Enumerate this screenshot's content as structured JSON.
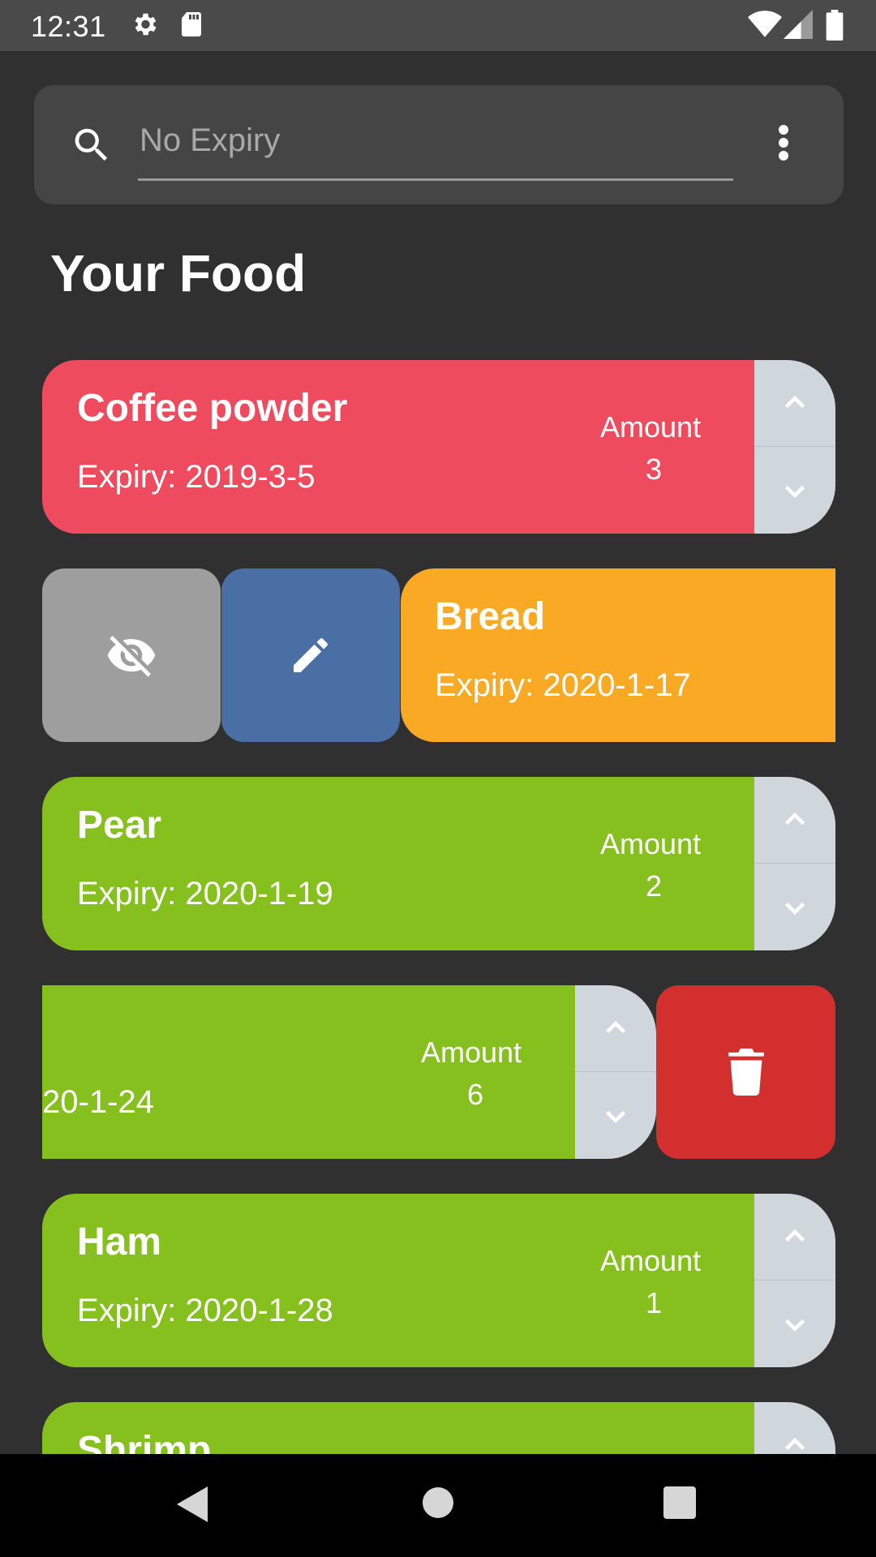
{
  "status_bar": {
    "time": "12:31",
    "icons": [
      "gear-icon",
      "sd-card-icon",
      "wifi-icon",
      "signal-icon",
      "battery-icon"
    ]
  },
  "search": {
    "placeholder": "No Expiry",
    "icon": "search-icon",
    "menu_icon": "more-vert-icon"
  },
  "title": "Your Food",
  "amount_label": "Amount",
  "colors": {
    "expired": "#ef4b5e",
    "soon": "#f9a924",
    "fresh": "#86c01f",
    "hide": "#9e9e9e",
    "edit": "#4a6fa5",
    "delete": "#d32f2f",
    "background": "#303030"
  },
  "items": [
    {
      "name": "Coffee powder",
      "expiry": "Expiry: 2019-3-5",
      "amount": "3",
      "status": "expired"
    },
    {
      "name": "Bread",
      "expiry": "Expiry: 2020-1-17",
      "status": "soon",
      "actions": [
        "hide-icon",
        "edit-icon"
      ]
    },
    {
      "name": "Pear",
      "expiry": "Expiry: 2020-1-19",
      "amount": "2",
      "status": "fresh"
    },
    {
      "expiry_fragment": "20-1-24",
      "amount": "6",
      "status": "fresh",
      "actions": [
        "delete-icon"
      ]
    },
    {
      "name": "Ham",
      "expiry": "Expiry: 2020-1-28",
      "amount": "1",
      "status": "fresh"
    },
    {
      "name": "Shrimp",
      "status": "fresh"
    }
  ],
  "nav_bar": {
    "buttons": [
      "back-icon",
      "home-icon",
      "recents-icon"
    ]
  }
}
